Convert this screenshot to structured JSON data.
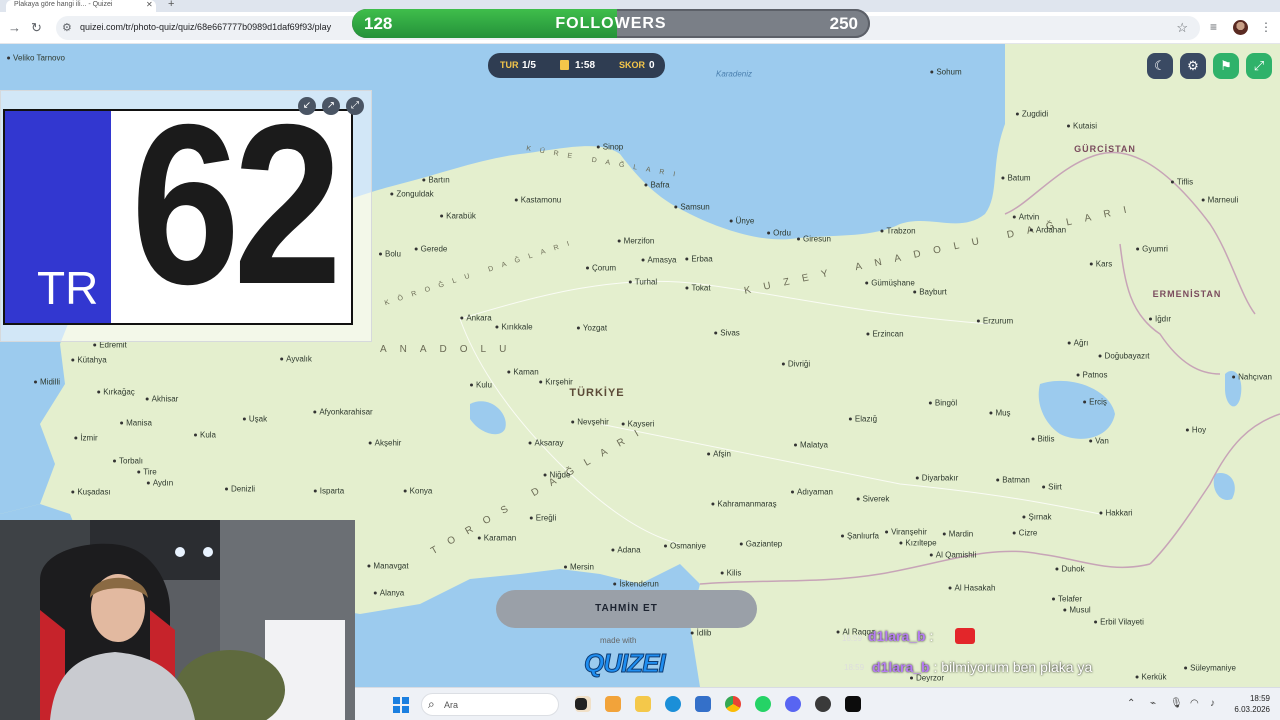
{
  "browser": {
    "tab_title": "Plakaya göre hangi ili... - Quizei",
    "url": "quizei.com/tr/photo-quiz/quiz/68e667777b0989d1daf69f93/play"
  },
  "followers": {
    "current": "128",
    "label": "FOLLOWERS",
    "goal": "250",
    "progress": 0.512
  },
  "hud": {
    "round_label": "TUR",
    "round_value": "1/5",
    "timer_value": "1:58",
    "score_label": "SKOR",
    "score_value": "0"
  },
  "photo": {
    "plate_country": "TR",
    "plate_number": "62"
  },
  "guess_button": "TAHMİN ET",
  "branding": {
    "made_with": "made with",
    "logo": "QUIZEI"
  },
  "map": {
    "country": "TÜRKİYE",
    "sea": "Karadeniz",
    "countries": {
      "georgia": "GÜRCİSTAN",
      "armenia": "ERMENİSTAN"
    },
    "regions": {
      "kuzey_anadolu": "KUZEY ANADOLU DAĞLARI",
      "koroglu": "KÖROĞLU DAĞLARI",
      "kure": "KÜRE DAĞLARI",
      "anadolu": "ANADOLU",
      "toros": "TOROS DAĞLARI"
    },
    "cities": [
      {
        "name": "Veliko Tarnovo"
      },
      {
        "name": "Sohum"
      },
      {
        "name": "Zugdidi"
      },
      {
        "name": "Kutaisi"
      },
      {
        "name": "Batum"
      },
      {
        "name": "Tiflis"
      },
      {
        "name": "Marneuli"
      },
      {
        "name": "Artvin"
      },
      {
        "name": "Ardahan"
      },
      {
        "name": "Gyumri"
      },
      {
        "name": "Kars"
      },
      {
        "name": "Sinop"
      },
      {
        "name": "Bartın"
      },
      {
        "name": "Zonguldak"
      },
      {
        "name": "Kastamonu"
      },
      {
        "name": "Karabük"
      },
      {
        "name": "Bafra"
      },
      {
        "name": "Samsun"
      },
      {
        "name": "Ünye"
      },
      {
        "name": "Ordu"
      },
      {
        "name": "Giresun"
      },
      {
        "name": "Trabzon"
      },
      {
        "name": "Bolu"
      },
      {
        "name": "Gerede"
      },
      {
        "name": "Merzifon"
      },
      {
        "name": "Çorum"
      },
      {
        "name": "Amasya"
      },
      {
        "name": "Erbaa"
      },
      {
        "name": "Turhal"
      },
      {
        "name": "Tokat"
      },
      {
        "name": "Gümüşhane"
      },
      {
        "name": "Bayburt"
      },
      {
        "name": "Erzurum"
      },
      {
        "name": "Erzincan"
      },
      {
        "name": "Ankara"
      },
      {
        "name": "Kırıkkale"
      },
      {
        "name": "Yozgat"
      },
      {
        "name": "Sivas"
      },
      {
        "name": "Iğdır"
      },
      {
        "name": "Ağrı"
      },
      {
        "name": "Doğubayazıt"
      },
      {
        "name": "Nahçıvan"
      },
      {
        "name": "Patnos"
      },
      {
        "name": "Divriği"
      },
      {
        "name": "Kaman"
      },
      {
        "name": "Kırşehir"
      },
      {
        "name": "Kulu"
      },
      {
        "name": "Kayseri"
      },
      {
        "name": "Nevşehir"
      },
      {
        "name": "Elazığ"
      },
      {
        "name": "Bingöl"
      },
      {
        "name": "Muş"
      },
      {
        "name": "Erciş"
      },
      {
        "name": "Bitlis"
      },
      {
        "name": "Van"
      },
      {
        "name": "Hoy"
      },
      {
        "name": "Aksaray"
      },
      {
        "name": "Malatya"
      },
      {
        "name": "Afşin"
      },
      {
        "name": "Niğde"
      },
      {
        "name": "Konya"
      },
      {
        "name": "Ereğli"
      },
      {
        "name": "Kahramanmaraş"
      },
      {
        "name": "Adıyaman"
      },
      {
        "name": "Siverek"
      },
      {
        "name": "Diyarbakır"
      },
      {
        "name": "Batman"
      },
      {
        "name": "Siirt"
      },
      {
        "name": "Şırnak"
      },
      {
        "name": "Hakkari"
      },
      {
        "name": "Şanlıurfa"
      },
      {
        "name": "Viranşehir"
      },
      {
        "name": "Kızıltepe"
      },
      {
        "name": "Mardin"
      },
      {
        "name": "Cizre"
      },
      {
        "name": "Al Qamishli"
      },
      {
        "name": "Duhok"
      },
      {
        "name": "Gaziantep"
      },
      {
        "name": "Osmaniye"
      },
      {
        "name": "Adana"
      },
      {
        "name": "Mersin"
      },
      {
        "name": "İskenderun"
      },
      {
        "name": "Kilis"
      },
      {
        "name": "Karaman"
      },
      {
        "name": "Al Hasakah"
      },
      {
        "name": "Telafer"
      },
      {
        "name": "Musul"
      },
      {
        "name": "Erbil Vilayeti"
      },
      {
        "name": "Edremit"
      },
      {
        "name": "Ayvalık"
      },
      {
        "name": "Kütahya"
      },
      {
        "name": "Midilli"
      },
      {
        "name": "Kırkağaç"
      },
      {
        "name": "Akhisar"
      },
      {
        "name": "Uşak"
      },
      {
        "name": "Afyonkarahisar"
      },
      {
        "name": "Manisa"
      },
      {
        "name": "Kula"
      },
      {
        "name": "İzmir"
      },
      {
        "name": "Akşehir"
      },
      {
        "name": "Torbalı"
      },
      {
        "name": "Tire"
      },
      {
        "name": "Aydın"
      },
      {
        "name": "Denizli"
      },
      {
        "name": "Isparta"
      },
      {
        "name": "Kuşadası"
      },
      {
        "name": "Manavgat"
      },
      {
        "name": "Alanya"
      },
      {
        "name": "Kerkük"
      },
      {
        "name": "Süleymaniye"
      },
      {
        "name": "Deyrzor"
      },
      {
        "name": "İdlib"
      },
      {
        "name": "Al Raqqa"
      }
    ]
  },
  "chat": [
    {
      "time": "18:59",
      "name": "d1lara_b",
      "sep": ":",
      "msg": ""
    },
    {
      "time": "18:59",
      "name": "d1lara_b",
      "sep": ":",
      "msg": "bilmiyorum ben plaka ya"
    }
  ],
  "taskbar": {
    "search_placeholder": "Ara",
    "time": "18:59",
    "date": "6.03.2026"
  }
}
